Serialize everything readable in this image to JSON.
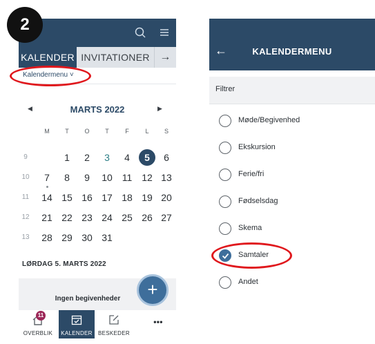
{
  "step_number": "2",
  "left": {
    "tabs": {
      "calendar": "KALENDER",
      "invitations": "INVITATIONER",
      "arrow": "→"
    },
    "menu_link": "Kalendermenu ˅",
    "month_title": "MARTS 2022",
    "nav": {
      "prev": "◀",
      "next": "▶"
    },
    "weekdays": [
      "M",
      "T",
      "O",
      "T",
      "F",
      "L",
      "S"
    ],
    "weeks": [
      {
        "week": "9",
        "days": [
          "",
          "1",
          "2",
          "3",
          "4",
          "5",
          "6"
        ]
      },
      {
        "week": "10",
        "days": [
          "7",
          "8",
          "9",
          "10",
          "11",
          "12",
          "13"
        ]
      },
      {
        "week": "11",
        "days": [
          "14",
          "15",
          "16",
          "17",
          "18",
          "19",
          "20"
        ]
      },
      {
        "week": "12",
        "days": [
          "21",
          "22",
          "23",
          "24",
          "25",
          "26",
          "27"
        ]
      },
      {
        "week": "13",
        "days": [
          "28",
          "29",
          "30",
          "31",
          "",
          "",
          ""
        ]
      }
    ],
    "today": "5",
    "date_heading": "LØRDAG 5. MARTS 2022",
    "no_events": "Ingen begivenheder",
    "fab": "+",
    "bottom_nav": {
      "overview": "OVERBLIK",
      "calendar": "KALENDER",
      "messages": "BESKEDER",
      "more": "•••",
      "badge": "11"
    }
  },
  "right": {
    "title": "KALENDERMENU",
    "back": "←",
    "filter_label": "Filtrer",
    "options": [
      {
        "label": "Møde/Begivenhed",
        "checked": false
      },
      {
        "label": "Ekskursion",
        "checked": false
      },
      {
        "label": "Ferie/fri",
        "checked": false
      },
      {
        "label": "Fødselsdag",
        "checked": false
      },
      {
        "label": "Skema",
        "checked": false
      },
      {
        "label": "Samtaler",
        "checked": true
      },
      {
        "label": "Andet",
        "checked": false
      }
    ]
  },
  "colors": {
    "primary": "#2c4a67",
    "accent": "#3e6e9b",
    "highlight": "#e0181d",
    "badge": "#9c2758"
  }
}
